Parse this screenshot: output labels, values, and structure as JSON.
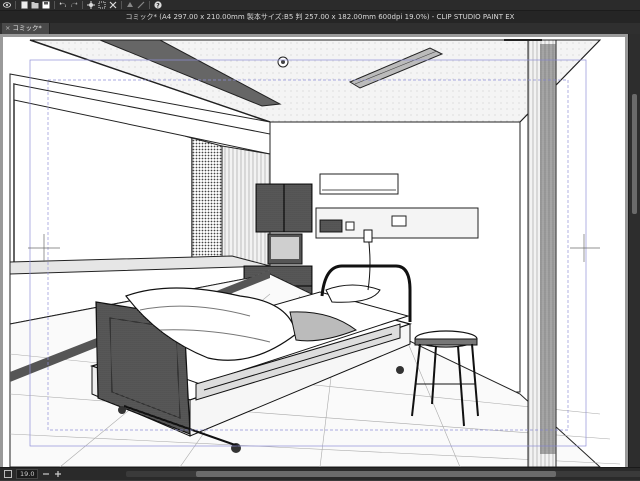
{
  "window": {
    "title": "コミック* (A4 297.00 x 210.00mm 製本サイズ:B5 判 257.00 x 182.00mm 600dpi 19.0%)  - CLIP STUDIO PAINT EX"
  },
  "tabs": [
    {
      "label": "コミック*",
      "close": "×"
    }
  ],
  "toolbar": {
    "icons": [
      "eye-icon",
      "new-file-icon",
      "open-file-icon",
      "save-icon",
      "undo-icon",
      "redo-icon",
      "clear-icon",
      "transform-icon",
      "crop-icon",
      "fill-icon",
      "selection-icon",
      "help-icon"
    ]
  },
  "status": {
    "zoom": "19.0"
  },
  "colors": {
    "chrome_dark": "#2b2b2b",
    "canvas_bg": "#ffffff",
    "workspace": "#9a9a9a",
    "line_art": "#1a1a1a"
  }
}
